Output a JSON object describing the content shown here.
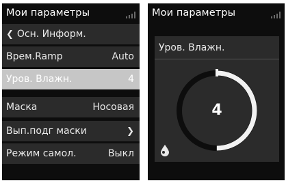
{
  "left": {
    "title": "Мои параметры",
    "menu": [
      {
        "label": "Осн. Информ.",
        "value": "",
        "kind": "back"
      },
      {
        "label": "Врем.Ramp",
        "value": "Auto"
      },
      {
        "label": "Уров. Влажн.",
        "value": "4",
        "selected": true
      },
      {
        "label": "Маска",
        "value": "Носовая"
      },
      {
        "label": "Вып.подг маски",
        "value": "",
        "kind": "submenu"
      },
      {
        "label": "Режим самол.",
        "value": "Выкл"
      }
    ]
  },
  "right": {
    "title": "Мои параметры",
    "setting_label": "Уров. Влажн.",
    "gauge": {
      "value": "4",
      "level": 4,
      "max": 8
    }
  },
  "icons": [
    "signal-icon",
    "chevron-left-icon",
    "chevron-right-icon",
    "water-drop-icon"
  ],
  "colors": {
    "background": "#0d0d0d",
    "row": "#2b2b2b",
    "selected": "#c6c6c6",
    "text": "#e9e9e9"
  }
}
